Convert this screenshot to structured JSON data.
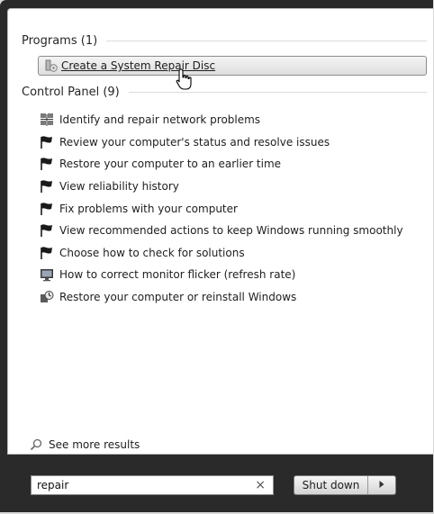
{
  "programs": {
    "header": "Programs (1)",
    "items": [
      {
        "label": "Create a System Repair Disc",
        "icon": "disc-program-icon"
      }
    ]
  },
  "control_panel": {
    "header": "Control Panel (9)",
    "items": [
      {
        "label": "Identify and repair network problems",
        "icon": "network-icon"
      },
      {
        "label": "Review your computer's status and resolve issues",
        "icon": "action-center-flag-icon"
      },
      {
        "label": "Restore your computer to an earlier time",
        "icon": "action-center-flag-icon"
      },
      {
        "label": "View reliability history",
        "icon": "action-center-flag-icon"
      },
      {
        "label": "Fix problems with your computer",
        "icon": "action-center-flag-icon"
      },
      {
        "label": "View recommended actions to keep Windows running smoothly",
        "icon": "action-center-flag-icon"
      },
      {
        "label": "Choose how to check for solutions",
        "icon": "action-center-flag-icon"
      },
      {
        "label": "How to correct monitor flicker (refresh rate)",
        "icon": "monitor-icon"
      },
      {
        "label": "Restore your computer or reinstall Windows",
        "icon": "recovery-icon"
      }
    ]
  },
  "see_more": "See more results",
  "search": {
    "value": "repair",
    "clear_glyph": "×"
  },
  "shutdown": {
    "label": "Shut down"
  },
  "colors": {
    "flag": "#1a1a1a",
    "pane_bg": "#ffffff",
    "frame_bg": "#2a2a2a"
  }
}
